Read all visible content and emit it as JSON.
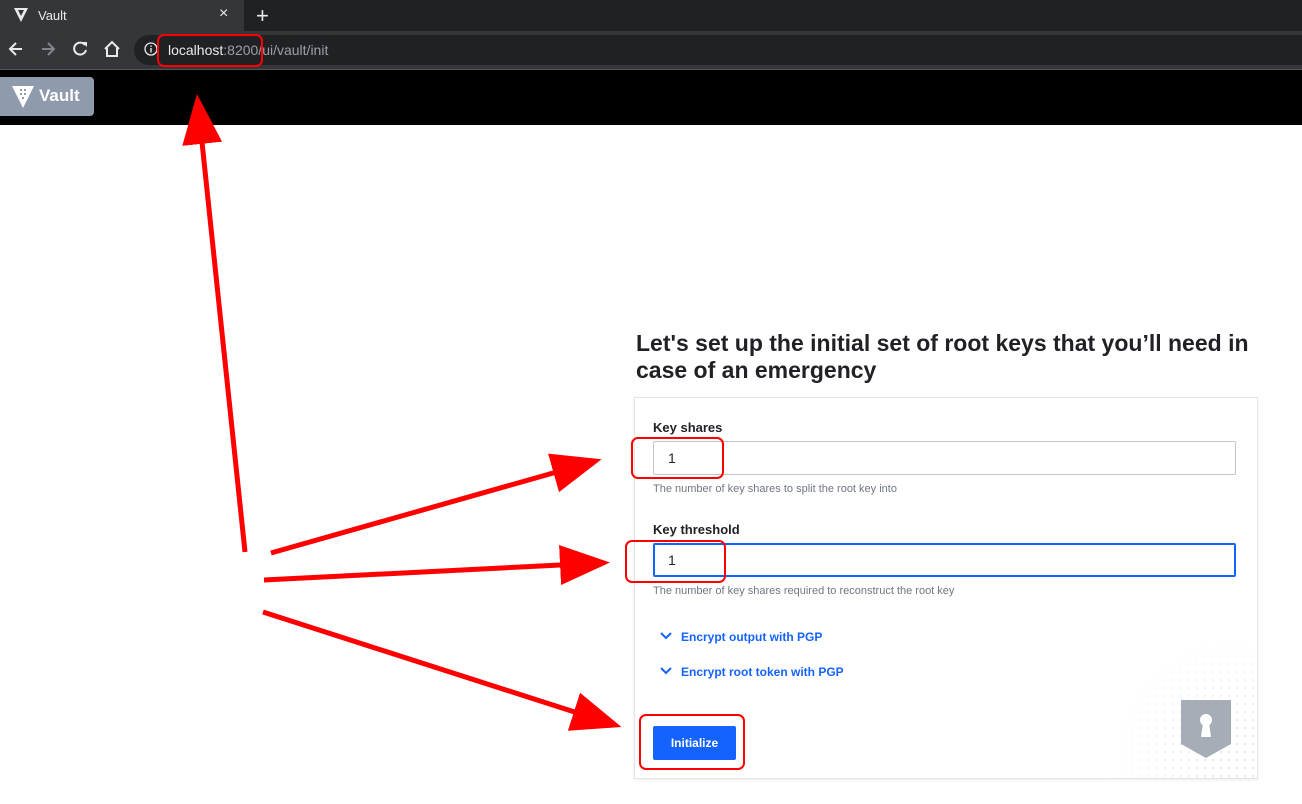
{
  "browser": {
    "tab_title": "Vault",
    "close_glyph": "×",
    "newtab_glyph": "+",
    "url_host": "localhost",
    "url_rest": ":8200/ui/vault/init"
  },
  "vault": {
    "logo_text": "Vault"
  },
  "page": {
    "heading": "Let's set up the initial set of root keys that you’ll need in case of an emergency",
    "key_shares": {
      "label": "Key shares",
      "value": "1",
      "help": "The number of key shares to split the root key into"
    },
    "key_threshold": {
      "label": "Key threshold",
      "value": "1",
      "help": "The number of key shares required to reconstruct the root key"
    },
    "toggles": [
      "Encrypt output with PGP",
      "Encrypt root token with PGP"
    ],
    "submit_label": "Initialize"
  },
  "colors": {
    "accent": "#1563ff",
    "annotation": "#ff0000"
  },
  "icons": [
    "vault-favicon-icon",
    "back-icon",
    "forward-icon",
    "reload-icon",
    "home-icon",
    "info-icon",
    "vault-logo-icon",
    "chevron-down-icon",
    "shield-keyhole-icon"
  ]
}
